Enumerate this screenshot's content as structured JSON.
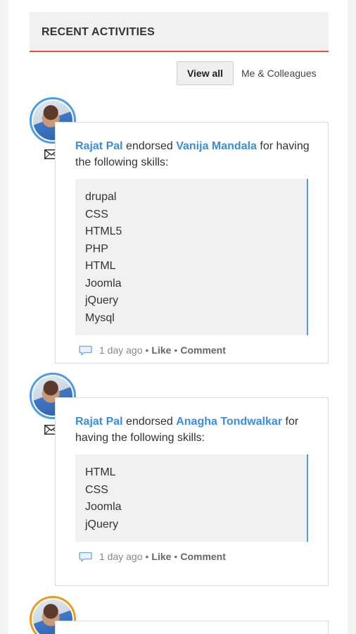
{
  "header": {
    "title": "RECENT ACTIVITIES"
  },
  "filters": {
    "view_all": "View all",
    "colleagues": "Me & Colleagues"
  },
  "activities": [
    {
      "actor": "Rajat Pal",
      "verb": "endorsed",
      "target": "Vanija Mandala",
      "suffix": "for having the following skills:",
      "skills": [
        "drupal",
        "CSS",
        "HTML5",
        "PHP",
        "HTML",
        "Joomla",
        "jQuery",
        "Mysql"
      ],
      "time": "1 day ago",
      "like": "Like",
      "comment": "Comment"
    },
    {
      "actor": "Rajat Pal",
      "verb": "endorsed",
      "target": "Anagha Tondwalkar",
      "suffix": "for having the following skills:",
      "skills": [
        "HTML",
        "CSS",
        "Joomla",
        "jQuery"
      ],
      "time": "1 day ago",
      "like": "Like",
      "comment": "Comment"
    }
  ],
  "colors": {
    "accent": "#3a8ee0",
    "header_rule": "#e0523f",
    "avatar_ring": "#4a9ee6",
    "avatar_ring_alt": "#ef9a1a"
  },
  "icons": {
    "mail": "envelope-icon",
    "comment": "comment-bubble-icon"
  }
}
